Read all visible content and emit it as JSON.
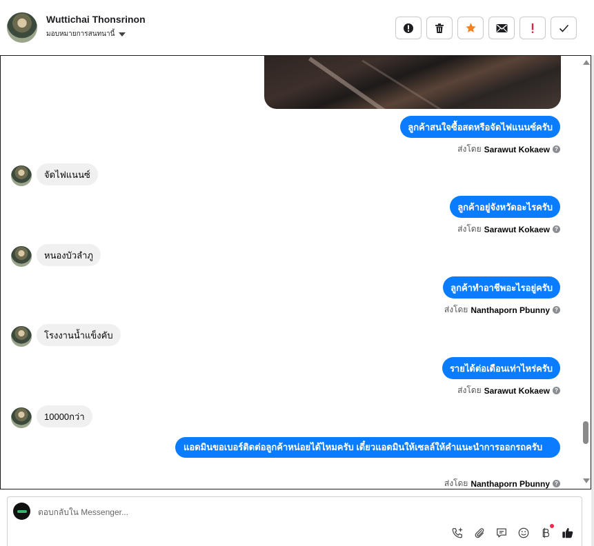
{
  "header": {
    "contact_name": "Wuttichai Thonsrinon",
    "assign_label": "มอบหมายการสนทนานี้",
    "actions": [
      {
        "name": "report-icon",
        "color": "#1c1e21"
      },
      {
        "name": "trash-icon",
        "color": "#1c1e21"
      },
      {
        "name": "star-icon",
        "color": "#f5821f"
      },
      {
        "name": "envelope-icon",
        "color": "#1c1e21"
      },
      {
        "name": "exclamation-icon",
        "color": "#e41e3f"
      },
      {
        "name": "check-icon",
        "color": "#1c1e21"
      }
    ]
  },
  "conversation": {
    "sent_by_prefix": "ส่งโดย",
    "messages": [
      {
        "type": "out",
        "text": "ลูกค้าสนใจซื้อสดหรือจัดไฟแนนซ์ครับ",
        "agent": "Sarawut Kokaew"
      },
      {
        "type": "in",
        "text": "จัดไฟแนนซ์"
      },
      {
        "type": "out",
        "text": "ลูกค้าอยู่จังหวัดอะไรครับ",
        "agent": "Sarawut Kokaew"
      },
      {
        "type": "in",
        "text": "หนองบัวลำภู"
      },
      {
        "type": "out",
        "text": "ลูกค้าทำอาชีพอะไรอยู่ครับ",
        "agent": "Nanthaporn Pbunny"
      },
      {
        "type": "in",
        "text": "โรงงานน้ำแข็งคับ"
      },
      {
        "type": "out",
        "text": "รายได้ต่อเดือนเท่าไหร่ครับ",
        "agent": "Sarawut Kokaew"
      },
      {
        "type": "in",
        "text": "10000กว่า"
      },
      {
        "type": "out",
        "text": "แอดมินขอเบอร์ติดต่อลูกค้าหน่อยได้ไหมครับ เดี๋ยวแอดมินให้เซลล์ให้คำแนะนำการออกรถครับ",
        "agent": "Nanthaporn Pbunny"
      }
    ],
    "scroll_position": 0.92
  },
  "composer": {
    "placeholder": "ตอบกลับใน Messenger...",
    "value": "",
    "tools": [
      "phone-add-icon",
      "paperclip-icon",
      "saved-reply-icon",
      "emoji-icon",
      "baht-payment-icon",
      "thumbs-up-icon"
    ]
  },
  "colors": {
    "outgoing_bubble": "#0a7cff",
    "incoming_bubble": "#f0f0f0",
    "notification_dot": "#f02849"
  }
}
